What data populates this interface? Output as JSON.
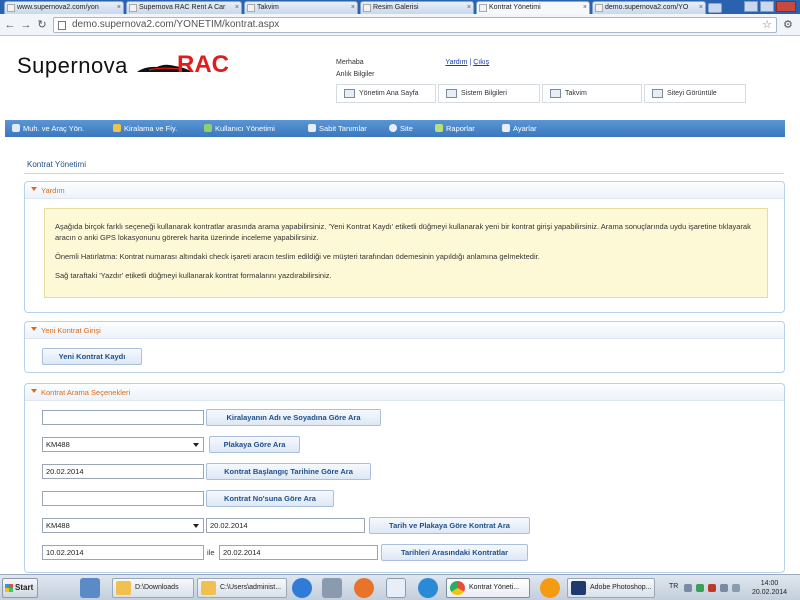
{
  "browser": {
    "tabs": [
      {
        "label": "www.supernova2.com/yon"
      },
      {
        "label": "Supernova RAC Rent A Car"
      },
      {
        "label": "Takvim"
      },
      {
        "label": "Resim Galerisi"
      },
      {
        "label": "Kontrat Yönetimi"
      },
      {
        "label": "demo.supernova2.com/YO"
      }
    ],
    "url": "demo.supernova2.com/YONETIM/kontrat.aspx"
  },
  "header": {
    "logo_text": "Supernova",
    "logo_rac": "RAC",
    "greeting_prefix": "Merhaba",
    "help_link": "Yardım",
    "separator": "|",
    "logout_link": "Çıkış",
    "clock_label": "Anlık Bilgiler",
    "quick_links": [
      {
        "label": "Yönetim Ana Sayfa"
      },
      {
        "label": "Sistem Bilgileri"
      },
      {
        "label": "Takvim"
      },
      {
        "label": "Siteyi Görüntüle"
      }
    ]
  },
  "menu": {
    "items": [
      {
        "label": "Muh. ve Araç Yön."
      },
      {
        "label": "Kiralama ve Fiy."
      },
      {
        "label": "Kullanıcı Yönetimi"
      },
      {
        "label": "Sabit Tanımlar"
      },
      {
        "label": "Site"
      },
      {
        "label": "Raporlar"
      },
      {
        "label": "Ayarlar"
      }
    ]
  },
  "page": {
    "title": "Kontrat Yönetimi",
    "help": {
      "heading": "Yardım",
      "p1": "Aşağıda birçok farklı seçeneği kullanarak kontratlar arasında arama yapabilirsiniz. 'Yeni Kontrat Kaydı' etiketli düğmeyi kullanarak yeni bir kontrat girişi yapabilirsiniz. Arama sonuçlarında uydu işaretine tıklayarak aracın o anki GPS lokasyonunu görerek harita üzerinde inceleme yapabilirsiniz.",
      "p2": "Önemli Hatırlatma: Kontrat numarası altındaki check işareti aracın teslim edildiği ve müşteri tarafından ödemesinin yapıldığı anlamına gelmektedir.",
      "p3": "Sağ taraftaki 'Yazdır' etiketli düğmeyi kullanarak kontrat formalarını yazdırabilirsiniz."
    },
    "new_contract": {
      "heading": "Yeni Kontrat Girişi",
      "button": "Yeni Kontrat Kaydı"
    },
    "search": {
      "heading": "Kontrat Arama Seçenekleri",
      "name_input": "",
      "name_button": "Kiralayanın Adı ve Soyadına Göre Ara",
      "plate_select": "KM488",
      "plate_button": "Plakaya Göre Ara",
      "start_date": "20.02.2014",
      "start_button": "Kontrat Başlangıç Tarihine Göre Ara",
      "contract_no_input": "",
      "contract_no_button": "Kontrat No'suna Göre Ara",
      "plate_select_2": "KM488",
      "plate_date": "20.02.2014",
      "date_plate_button": "Tarih ve Plakaya Göre Kontrat Ara",
      "range_from": "10.02.2014",
      "range_word": "ile",
      "range_to": "20.02.2014",
      "range_button": "Tarihleri Arasındaki Kontratlar"
    }
  },
  "taskbar": {
    "start": "Start",
    "items": [
      {
        "label": "D:\\Downloads"
      },
      {
        "label": "C:\\Users\\administ..."
      },
      {
        "label": "Kontrat Yöneti..."
      },
      {
        "label": "Adobe Photoshop..."
      }
    ],
    "lang": "TR",
    "time": "14:00",
    "date": "20.02.2014"
  }
}
